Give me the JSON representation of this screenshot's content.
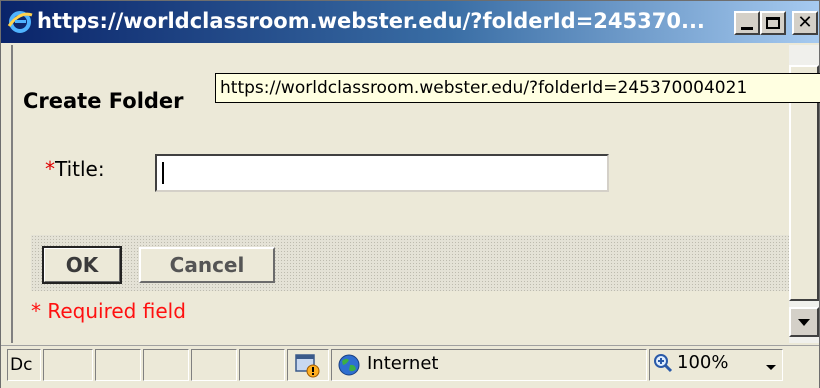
{
  "window": {
    "title": "https://worldclassroom.webster.edu/?folderId=245370...",
    "tooltip": "https://worldclassroom.webster.edu/?folderId=245370004021"
  },
  "form": {
    "heading": "Create Folder",
    "title_required_marker": "*",
    "title_label": "Title:",
    "title_value": "",
    "ok_label": "OK",
    "cancel_label": "Cancel",
    "required_note": "* Required field"
  },
  "statusbar": {
    "status_text": "Dc",
    "zone": "Internet",
    "zoom": "100%"
  },
  "colors": {
    "required": "#ff1010",
    "titlebar": "#0a246a"
  },
  "icons": {
    "title": "ie-icon",
    "zone": "globe-icon",
    "security": "lock-warning-icon",
    "zoom": "zoom-icon"
  }
}
